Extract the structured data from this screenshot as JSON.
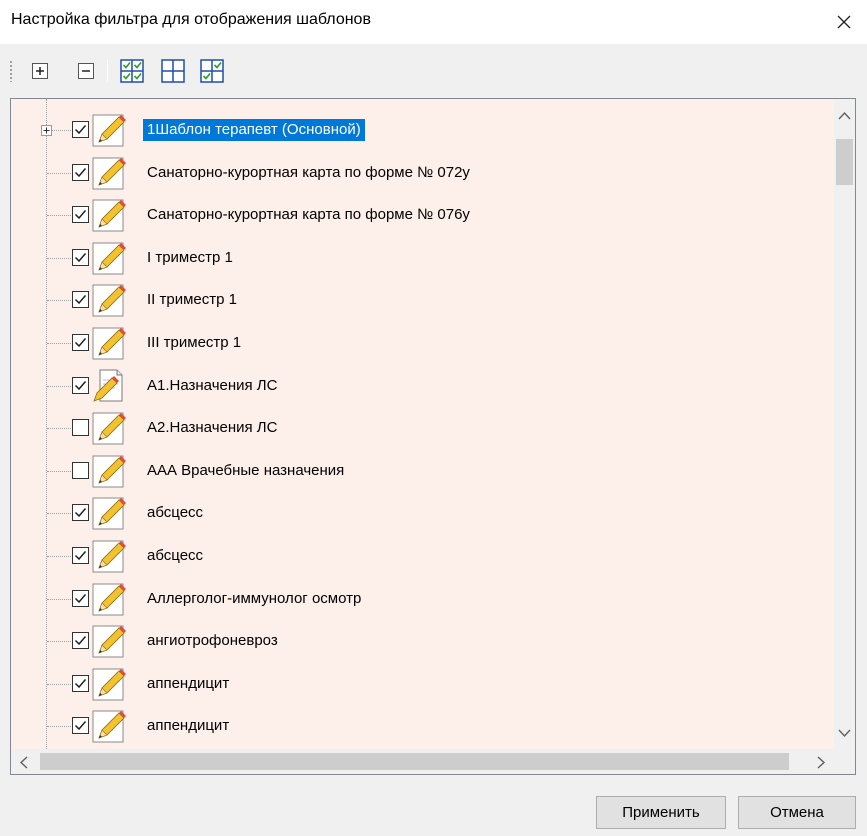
{
  "window": {
    "title": "Настройка фильтра для отображения шаблонов",
    "close_icon": "close-icon"
  },
  "toolbar": {
    "buttons": [
      {
        "icon": "expand-all-icon"
      },
      {
        "icon": "collapse-all-icon"
      },
      {
        "icon": "check-all-icon"
      },
      {
        "icon": "uncheck-all-icon"
      },
      {
        "icon": "invert-check-icon"
      }
    ]
  },
  "tree": {
    "items": [
      {
        "label": "1Шаблон терапевт (Основной)",
        "checked": true,
        "expandable": true,
        "selected": true,
        "icon": "template-edit-icon"
      },
      {
        "label": "Санаторно-курортная карта по форме № 072у",
        "checked": true,
        "icon": "template-edit-icon"
      },
      {
        "label": "Санаторно-курортная карта по форме № 076у",
        "checked": true,
        "icon": "template-edit-icon"
      },
      {
        "label": "I триместр 1",
        "checked": true,
        "icon": "template-edit-icon"
      },
      {
        "label": "II триместр 1",
        "checked": true,
        "icon": "template-edit-icon"
      },
      {
        "label": "III триместр 1",
        "checked": true,
        "icon": "template-edit-icon"
      },
      {
        "label": "А1.Назначения ЛС",
        "checked": true,
        "icon": "document-edit-icon"
      },
      {
        "label": "А2.Назначения ЛС",
        "checked": false,
        "icon": "template-edit-icon"
      },
      {
        "label": "ААА Врачебные назначения",
        "checked": false,
        "icon": "template-edit-icon"
      },
      {
        "label": "абсцесс",
        "checked": true,
        "icon": "template-edit-icon"
      },
      {
        "label": "абсцесс",
        "checked": true,
        "icon": "template-edit-icon"
      },
      {
        "label": "Аллерголог-иммунолог осмотр",
        "checked": true,
        "icon": "template-edit-icon"
      },
      {
        "label": "ангиотрофоневроз",
        "checked": true,
        "icon": "template-edit-icon"
      },
      {
        "label": "аппендицит",
        "checked": true,
        "icon": "template-edit-icon"
      },
      {
        "label": "аппендицит",
        "checked": true,
        "icon": "template-edit-icon"
      }
    ]
  },
  "buttons": {
    "apply": "Применить",
    "cancel": "Отмена"
  },
  "colors": {
    "tree_background": "#fdf0ea",
    "selection": "#0078d7"
  }
}
